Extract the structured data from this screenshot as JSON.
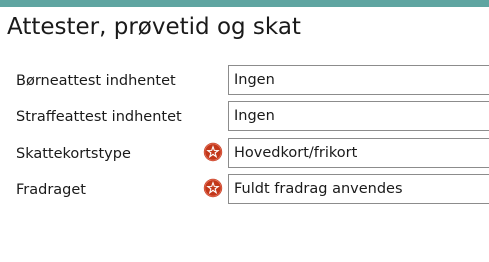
{
  "colors": {
    "top_bar": "#5fa5a1",
    "required_icon": "#c2371a"
  },
  "page": {
    "title": "Attester, prøvetid og skat"
  },
  "fields": [
    {
      "label": "Børneattest indhentet",
      "value": "Ingen",
      "required": false
    },
    {
      "label": "Straffeattest indhentet",
      "value": "Ingen",
      "required": false
    },
    {
      "label": "Skattekortstype",
      "value": "Hovedkort/frikort",
      "required": true,
      "icon": "required-star-icon"
    },
    {
      "label": "Fradraget",
      "value": "Fuldt fradrag anvendes",
      "required": true,
      "icon": "required-star-icon"
    }
  ]
}
